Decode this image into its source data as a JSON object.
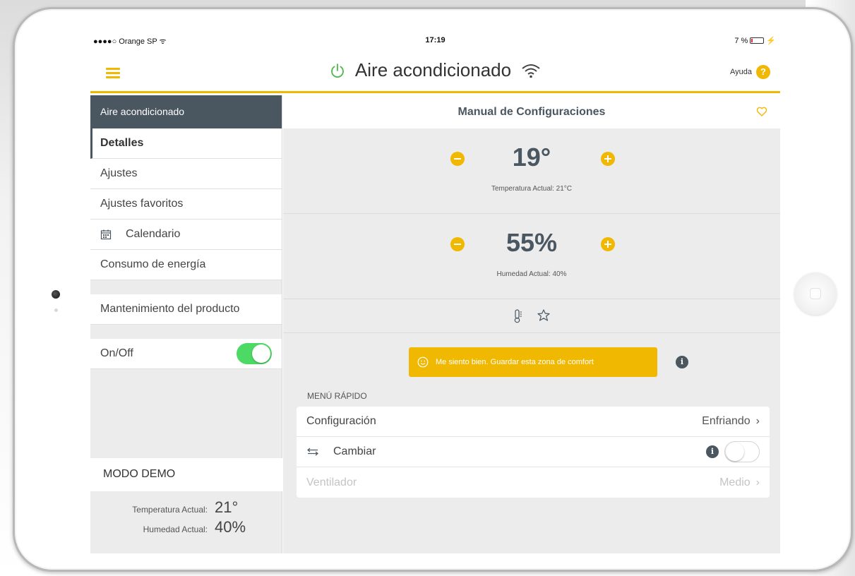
{
  "status_bar": {
    "carrier": "●●●●○ Orange SP ᯤ",
    "time": "17:19",
    "battery": "7 %"
  },
  "navbar": {
    "title": "Aire acondicionado",
    "help_label": "Ayuda",
    "help_icon": "?"
  },
  "sidebar": {
    "header": "Aire acondicionado",
    "items": [
      {
        "label": "Detalles"
      },
      {
        "label": "Ajustes"
      },
      {
        "label": "Ajustes favoritos"
      },
      {
        "label": "Calendario",
        "icon": "calendar-icon"
      },
      {
        "label": "Consumo de energía"
      }
    ],
    "maintenance": "Mantenimiento del producto",
    "onoff_label": "On/Off",
    "onoff_state": true,
    "demo_label": "MODO DEMO",
    "demo_temp_label": "Temperatura Actual:",
    "demo_temp_value": "21°",
    "demo_hum_label": "Humedad Actual:",
    "demo_hum_value": "40%"
  },
  "main": {
    "header": "Manual de Configuraciones",
    "temperature": {
      "value": "19°",
      "sub": "Temperatura Actual: 21°C"
    },
    "humidity": {
      "value": "55%",
      "sub": "Humedad Actual: 40%"
    },
    "comfort_button": "Me siento bien. Guardar esta zona de comfort",
    "info_icon": "i",
    "quick_menu_label": "MENÚ RÁPIDO",
    "quick_menu": {
      "config_label": "Configuración",
      "config_value": "Enfriando",
      "switch_label": "Cambiar",
      "switch_state": false,
      "fan_label": "Ventilador",
      "fan_value": "Medio"
    }
  },
  "colors": {
    "accent": "#f0b800",
    "dark": "#4a5660",
    "toggle_on": "#4cd964"
  }
}
